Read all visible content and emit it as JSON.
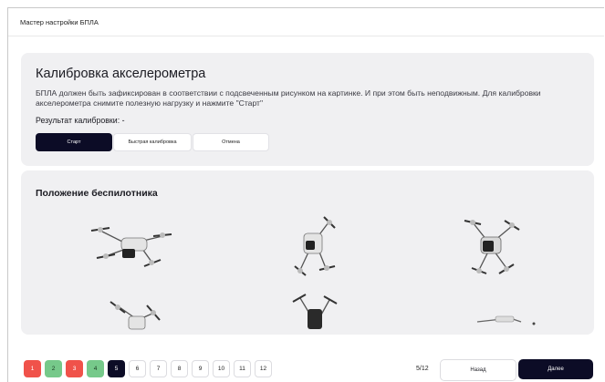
{
  "window": {
    "title": "Мастер настройки БПЛА"
  },
  "calibration": {
    "heading": "Калибровка акселерометра",
    "description": "БПЛА должен быть зафиксирован в соответствии с подсвеченным рисунком на картинке. И при этом быть неподвижным. Для калибровки акселерометра снимите полезную нагрузку и нажмите \"Старт\"",
    "result": "Результат калибровки: -",
    "buttons": {
      "start": "Старт",
      "quick": "Быстрая калибровка",
      "cancel": "Отмена"
    }
  },
  "position": {
    "heading": "Положение беспилотника",
    "images": [
      "drone-level-icon",
      "drone-nose-down-icon",
      "drone-nose-up-icon",
      "drone-left-side-icon",
      "drone-right-side-icon",
      "drone-upside-down-icon"
    ]
  },
  "steps": {
    "items": [
      {
        "label": "1",
        "state": "error"
      },
      {
        "label": "2",
        "state": "done"
      },
      {
        "label": "3",
        "state": "error"
      },
      {
        "label": "4",
        "state": "done"
      },
      {
        "label": "5",
        "state": "current"
      },
      {
        "label": "6",
        "state": "pending"
      },
      {
        "label": "7",
        "state": "pending"
      },
      {
        "label": "8",
        "state": "pending"
      },
      {
        "label": "9",
        "state": "pending"
      },
      {
        "label": "10",
        "state": "pending"
      },
      {
        "label": "11",
        "state": "pending"
      },
      {
        "label": "12",
        "state": "pending"
      }
    ],
    "counter": "5/12"
  },
  "nav": {
    "back": "Назад",
    "next": "Далее"
  },
  "colors": {
    "accent": "#0c0c26",
    "error": "#f0524a",
    "done": "#76c98a",
    "card": "#f0f0f2"
  }
}
